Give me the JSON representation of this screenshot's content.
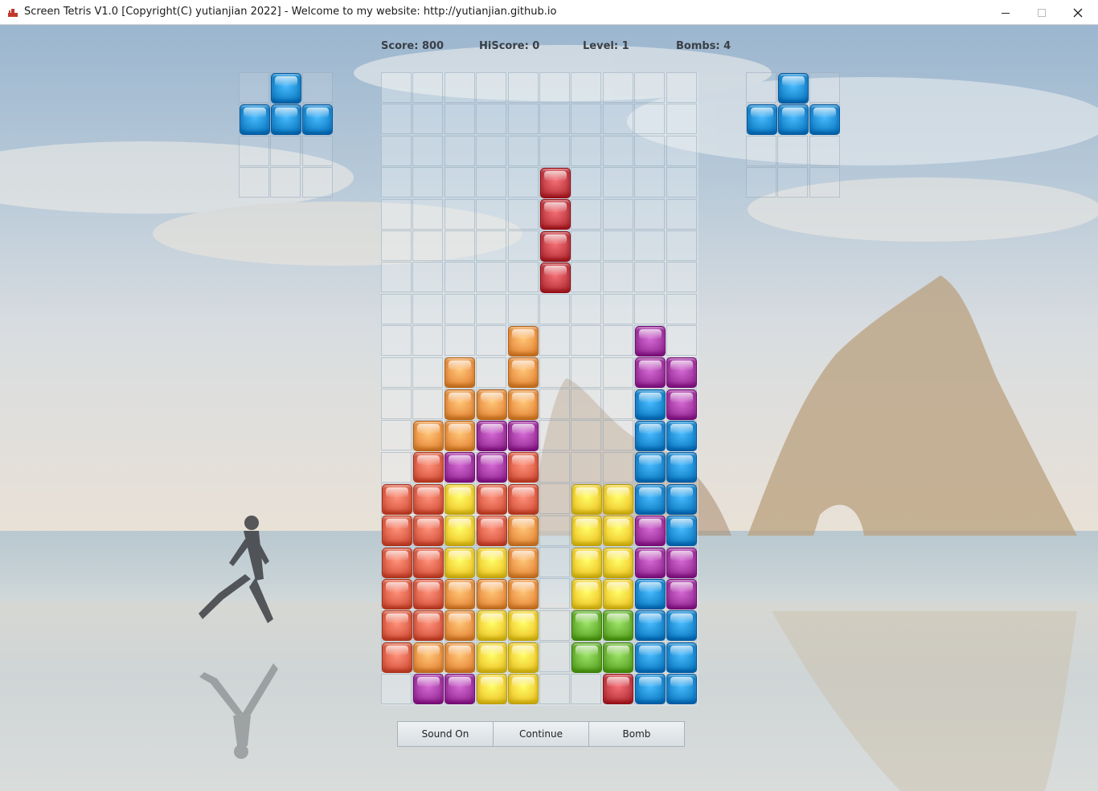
{
  "window": {
    "title": "Screen Tetris V1.0 [Copyright(C) yutianjian 2022] - Welcome to my website: http://yutianjian.github.io"
  },
  "hud": {
    "score": "Score: 800",
    "hiscore": "HiScore: 0",
    "level": "Level: 1",
    "bombs": "Bombs: 4"
  },
  "colors": {
    "red": "#c8434a",
    "salmon": "#e2664f",
    "orange": "#ee9a4c",
    "yellow": "#f4d63c",
    "green": "#6fb73a",
    "blue": "#1f8fd6",
    "magenta": "#a93ea8"
  },
  "board": {
    "cols": 10,
    "rows": 20,
    "falling_piece": {
      "color": "red",
      "cells": [
        [
          5,
          3
        ],
        [
          5,
          4
        ],
        [
          5,
          5
        ],
        [
          5,
          6
        ]
      ]
    },
    "cells": [
      [
        4,
        8,
        "orange"
      ],
      [
        8,
        8,
        "magenta"
      ],
      [
        2,
        9,
        "orange"
      ],
      [
        4,
        9,
        "orange"
      ],
      [
        8,
        9,
        "magenta"
      ],
      [
        9,
        9,
        "magenta"
      ],
      [
        2,
        10,
        "orange"
      ],
      [
        3,
        10,
        "orange"
      ],
      [
        4,
        10,
        "orange"
      ],
      [
        8,
        10,
        "blue"
      ],
      [
        9,
        10,
        "magenta"
      ],
      [
        1,
        11,
        "orange"
      ],
      [
        2,
        11,
        "orange"
      ],
      [
        3,
        11,
        "magenta"
      ],
      [
        4,
        11,
        "magenta"
      ],
      [
        8,
        11,
        "blue"
      ],
      [
        9,
        11,
        "blue"
      ],
      [
        1,
        12,
        "salmon"
      ],
      [
        2,
        12,
        "magenta"
      ],
      [
        3,
        12,
        "magenta"
      ],
      [
        4,
        12,
        "salmon"
      ],
      [
        8,
        12,
        "blue"
      ],
      [
        9,
        12,
        "blue"
      ],
      [
        0,
        13,
        "salmon"
      ],
      [
        1,
        13,
        "salmon"
      ],
      [
        2,
        13,
        "yellow"
      ],
      [
        3,
        13,
        "salmon"
      ],
      [
        4,
        13,
        "salmon"
      ],
      [
        6,
        13,
        "yellow"
      ],
      [
        7,
        13,
        "yellow"
      ],
      [
        8,
        13,
        "blue"
      ],
      [
        9,
        13,
        "blue"
      ],
      [
        0,
        14,
        "salmon"
      ],
      [
        1,
        14,
        "salmon"
      ],
      [
        2,
        14,
        "yellow"
      ],
      [
        3,
        14,
        "salmon"
      ],
      [
        4,
        14,
        "orange"
      ],
      [
        6,
        14,
        "yellow"
      ],
      [
        7,
        14,
        "yellow"
      ],
      [
        8,
        14,
        "magenta"
      ],
      [
        9,
        14,
        "blue"
      ],
      [
        0,
        15,
        "salmon"
      ],
      [
        1,
        15,
        "salmon"
      ],
      [
        2,
        15,
        "yellow"
      ],
      [
        3,
        15,
        "yellow"
      ],
      [
        4,
        15,
        "orange"
      ],
      [
        6,
        15,
        "yellow"
      ],
      [
        7,
        15,
        "yellow"
      ],
      [
        8,
        15,
        "magenta"
      ],
      [
        9,
        15,
        "magenta"
      ],
      [
        0,
        16,
        "salmon"
      ],
      [
        1,
        16,
        "salmon"
      ],
      [
        2,
        16,
        "orange"
      ],
      [
        3,
        16,
        "orange"
      ],
      [
        4,
        16,
        "orange"
      ],
      [
        6,
        16,
        "yellow"
      ],
      [
        7,
        16,
        "yellow"
      ],
      [
        8,
        16,
        "blue"
      ],
      [
        9,
        16,
        "magenta"
      ],
      [
        0,
        17,
        "salmon"
      ],
      [
        1,
        17,
        "salmon"
      ],
      [
        2,
        17,
        "orange"
      ],
      [
        3,
        17,
        "yellow"
      ],
      [
        4,
        17,
        "yellow"
      ],
      [
        6,
        17,
        "green"
      ],
      [
        7,
        17,
        "green"
      ],
      [
        8,
        17,
        "blue"
      ],
      [
        9,
        17,
        "blue"
      ],
      [
        0,
        18,
        "salmon"
      ],
      [
        1,
        18,
        "orange"
      ],
      [
        2,
        18,
        "orange"
      ],
      [
        3,
        18,
        "yellow"
      ],
      [
        4,
        18,
        "yellow"
      ],
      [
        6,
        18,
        "green"
      ],
      [
        7,
        18,
        "green"
      ],
      [
        8,
        18,
        "blue"
      ],
      [
        9,
        18,
        "blue"
      ],
      [
        1,
        19,
        "magenta"
      ],
      [
        2,
        19,
        "magenta"
      ],
      [
        3,
        19,
        "yellow"
      ],
      [
        4,
        19,
        "yellow"
      ],
      [
        7,
        19,
        "red"
      ],
      [
        8,
        19,
        "blue"
      ],
      [
        9,
        19,
        "blue"
      ]
    ]
  },
  "preview_left": {
    "cols": 3,
    "rows": 4,
    "cells": [
      [
        1,
        0,
        "blue"
      ],
      [
        0,
        1,
        "blue"
      ],
      [
        1,
        1,
        "blue"
      ],
      [
        2,
        1,
        "blue"
      ]
    ]
  },
  "preview_right": {
    "cols": 3,
    "rows": 4,
    "cells": [
      [
        1,
        0,
        "blue"
      ],
      [
        0,
        1,
        "blue"
      ],
      [
        1,
        1,
        "blue"
      ],
      [
        2,
        1,
        "blue"
      ]
    ]
  },
  "controls": {
    "sound_label": "Sound On",
    "continue_label": "Continue",
    "bomb_label": "Bomb"
  }
}
